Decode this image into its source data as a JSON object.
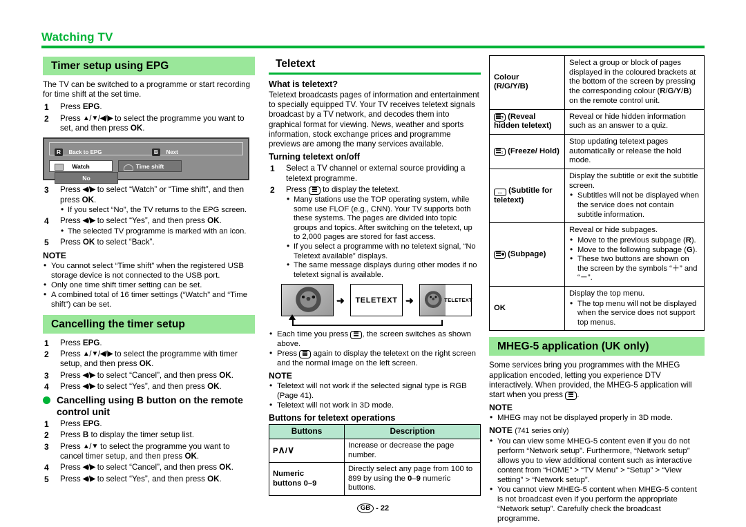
{
  "chapter": {
    "title": "Watching TV"
  },
  "footer": {
    "region": "GB",
    "separator": "-",
    "page": "22"
  },
  "colors": {
    "accent_green": "#00b336",
    "bar_green": "#9ae79a",
    "table_header_green": "#b7e7cf"
  },
  "left": {
    "section1_title": "Timer setup using EPG",
    "intro": "The TV can be switched to a programme or start recording for time shift at the set time.",
    "steps1": [
      {
        "num": "1",
        "text_html": "Press <b>EPG</b>."
      },
      {
        "num": "2",
        "text_html": "Press <b class=\"ar\">▲</b>/<b class=\"ar\">▼</b>/<b class=\"ar\">◀</b>/<b class=\"ar\">▶</b> to select the programme you want to set, and then press <b>OK</b>."
      }
    ],
    "epg_dialog": {
      "key_r": "R",
      "key_r_label": "Back to EPG",
      "key_b": "B",
      "key_b_label": "Next",
      "btn_watch": "Watch",
      "btn_timeshift": "Time shift",
      "btn_no": "No"
    },
    "steps2": [
      {
        "num": "3",
        "text_html": "Press <b class=\"ar\">◀</b>/<b class=\"ar\">▶</b> to select “Watch” or “Time shift”, and then press <b>OK</b>.",
        "bullets": [
          "If you select “No”, the TV returns to the EPG screen."
        ]
      },
      {
        "num": "4",
        "text_html": "Press <b class=\"ar\">◀</b>/<b class=\"ar\">▶</b> to select “Yes”, and then press <b>OK</b>.",
        "bullets": [
          "The selected TV programme is marked with an icon."
        ]
      },
      {
        "num": "5",
        "text_html": "Press <b>OK</b> to select “Back”.",
        "bullets": []
      }
    ],
    "note_label": "NOTE",
    "notes": [
      "You cannot select “Time shift” when the registered USB storage device is not connected to the USB port.",
      "Only one time shift timer setting can be set.",
      "A combined total of 16 timer settings (“Watch” and “Time shift”) can be set."
    ],
    "section2_title": "Cancelling the timer setup",
    "steps3": [
      {
        "num": "1",
        "text_html": "Press <b>EPG</b>."
      },
      {
        "num": "2",
        "text_html": "Press <b class=\"ar\">▲</b>/<b class=\"ar\">▼</b>/<b class=\"ar\">◀</b>/<b class=\"ar\">▶</b> to select the programme with timer setup, and then press <b>OK</b>."
      },
      {
        "num": "3",
        "text_html": "Press <b class=\"ar\">◀</b>/<b class=\"ar\">▶</b> to select “Cancel”, and then press <b>OK</b>."
      },
      {
        "num": "4",
        "text_html": "Press <b class=\"ar\">◀</b>/<b class=\"ar\">▶</b> to select “Yes”, and then press <b>OK</b>."
      }
    ],
    "subsection_title": "Cancelling using B button on the remote control unit",
    "steps4": [
      {
        "num": "1",
        "text_html": "Press <b>EPG</b>."
      },
      {
        "num": "2",
        "text_html": "Press <b>B</b> to display the timer setup list."
      },
      {
        "num": "3",
        "text_html": "Press <b class=\"ar\">▲</b>/<b class=\"ar\">▼</b> to select the programme you want to cancel timer setup, and then press <b>OK</b>."
      },
      {
        "num": "4",
        "text_html": "Press <b class=\"ar\">◀</b>/<b class=\"ar\">▶</b> to select “Cancel”, and then press <b>OK</b>."
      },
      {
        "num": "5",
        "text_html": "Press <b class=\"ar\">◀</b>/<b class=\"ar\">▶</b> to select “Yes”, and then press <b>OK</b>."
      }
    ]
  },
  "middle": {
    "section_title": "Teletext",
    "what_heading": "What is teletext?",
    "what_body": "Teletext broadcasts pages of information and entertainment to specially equipped TV. Your TV receives teletext signals broadcast by a TV network, and decodes them into graphical format for viewing. News, weather and sports information, stock exchange prices and programme previews are among the many services available.",
    "turning_heading": "Turning teletext on/off",
    "steps": [
      {
        "num": "1",
        "text_html": "Select a TV channel or external source providing a teletext programme.",
        "bullets": []
      },
      {
        "num": "2",
        "text_html": "Press <span class=\"glyph\"><span class=\"bars\"></span></span> to display the teletext.",
        "bullets": [
          "Many stations use the TOP operating system, while some use FLOF (e.g., CNN). Your TV supports both these systems. The pages are divided into topic groups and topics. After switching on the teletext, up to 2,000 pages are stored for fast access.",
          "If you select a programme with no teletext signal, “No Teletext available” displays.",
          "The same message displays during other modes if no teletext signal is available."
        ]
      }
    ],
    "figure": {
      "label_center": "TELETEXT",
      "label_right": "TELETEXT",
      "arrow": "➜"
    },
    "figure_bullets": [
      "Each time you press <span class=\"glyph\"><span class=\"bars\"></span></span>, the screen switches as shown above.",
      "Press <span class=\"glyph\"><span class=\"bars\"></span></span> again to display the teletext on the right screen and the normal image on the left screen."
    ],
    "note_label": "NOTE",
    "notes": [
      "Teletext will not work if the selected signal type is RGB (Page 41).",
      "Teletext will not work in 3D mode."
    ],
    "buttons_heading": "Buttons for teletext operations",
    "table": {
      "headers": [
        "Buttons",
        "Description"
      ],
      "rows": [
        {
          "key_html": "P<span style=\"font-size:14px\">∧</span>/<span style=\"font-size:14px\">∨</span>",
          "desc_html": "Increase or decrease the page number."
        },
        {
          "key_html": "Numeric<br>buttons <b>0</b>–<b>9</b>",
          "desc_html": "Directly select any page from 100 to 899 by using the <b>0</b>–<b>9</b> numeric buttons."
        }
      ]
    }
  },
  "right": {
    "table_rows": [
      {
        "key_html": "Colour<br>(R/G/Y/B)",
        "desc_html": "Select a group or block of pages displayed in the coloured brackets at the bottom of the screen by pressing the corresponding colour (<b>R</b>/<b>G</b>/<b>Y</b>/<b>B</b>) on the remote control unit.",
        "bullets": []
      },
      {
        "key_html": "<span class=\"glyph\"><span class=\"bars\"></span>?</span> (Reveal hidden teletext)",
        "desc_html": "Reveal or hide hidden information such as an answer to a quiz.",
        "bullets": []
      },
      {
        "key_html": "<span class=\"glyph\"><span class=\"bars\"></span>↕</span> (Freeze/ Hold)",
        "desc_html": "Stop updating teletext pages automatically or release the hold mode.",
        "bullets": []
      },
      {
        "key_html": "<span class=\"glyph sub\">…</span> (Subtitle for teletext)",
        "desc_html": "Display the subtitle or exit the subtitle screen.",
        "bullets": [
          "Subtitles will not be displayed when the service does not contain subtitle information."
        ]
      },
      {
        "key_html": "<span class=\"glyph\"><span class=\"bars\"></span><span class=\"glyph-dot\"></span></span> (Subpage)",
        "desc_html": "Reveal or hide subpages.",
        "bullets": [
          "Move to the previous subpage (<b>R</b>).",
          "Move to the following subpage (<b>G</b>).",
          "These two buttons are shown on the screen by the symbols “＋” and “－”."
        ]
      },
      {
        "key_html": "OK",
        "desc_html": "Display the top menu.",
        "bullets": [
          "The top menu will not be displayed when the service does not support top menus."
        ]
      }
    ],
    "section_title": "MHEG-5 application (UK only)",
    "intro_html": "Some services bring you programmes with the MHEG application encoded, letting you experience DTV interactively. When provided, the MHEG-5 application will start when you press <span class=\"glyph\"><span class=\"bars\"></span></span>.",
    "note_label": "NOTE",
    "notes1": [
      "MHEG may not be displayed properly in 3D mode."
    ],
    "note2_label": "NOTE",
    "note2_sub": "(741 series only)",
    "notes2": [
      "You can view some MHEG-5 content even if you do not perform “Network setup”. Furthermore, “Network setup” allows you to view additional content such as interactive content from “HOME” > “TV Menu” > “Setup” > “View setting” > “Network setup”.",
      "You cannot view MHEG-5 content when MHEG-5 content is not broadcast even if you perform the appropriate “Network setup”. Carefully check the broadcast programme."
    ]
  }
}
